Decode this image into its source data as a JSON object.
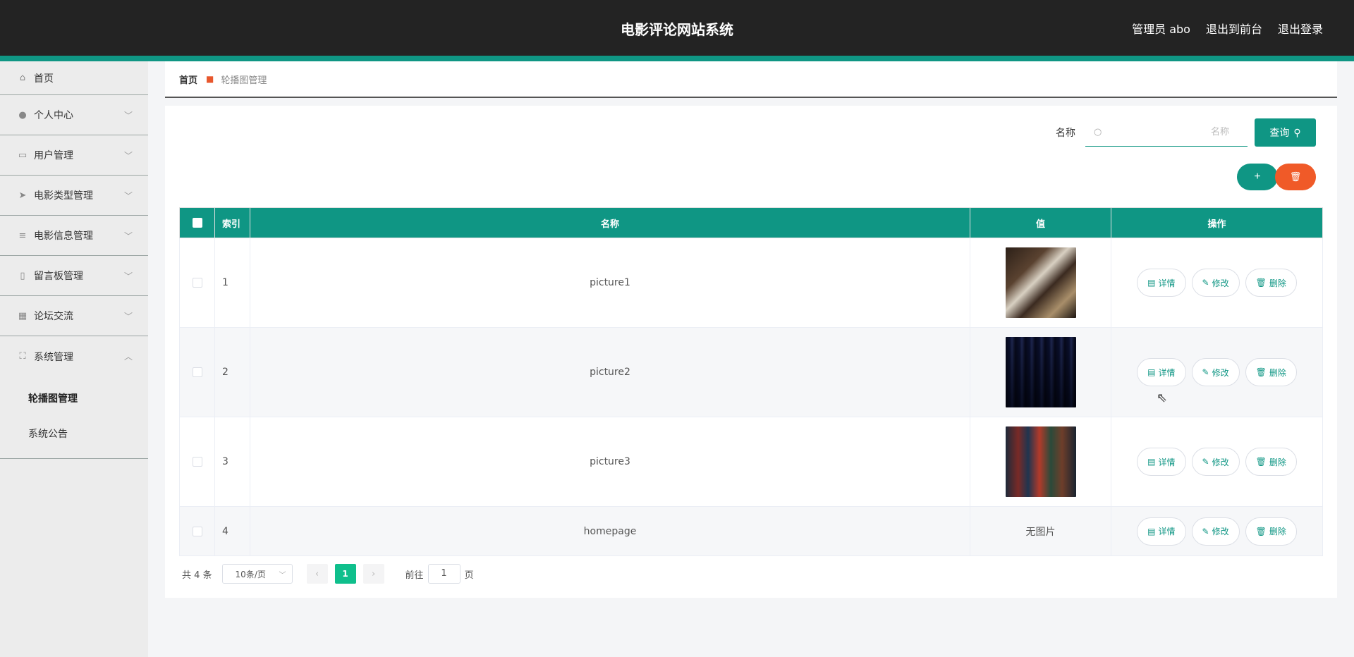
{
  "header": {
    "title": "电影评论网站系统",
    "user": "管理员 abo",
    "to_front": "退出到前台",
    "logout": "退出登录"
  },
  "sidebar": {
    "items": [
      {
        "label": "首页",
        "icon": "home-icon"
      },
      {
        "label": "个人中心",
        "icon": "user-icon"
      },
      {
        "label": "用户管理",
        "icon": "chat-icon"
      },
      {
        "label": "电影类型管理",
        "icon": "send-icon"
      },
      {
        "label": "电影信息管理",
        "icon": "list-icon"
      },
      {
        "label": "留言板管理",
        "icon": "mic-icon"
      },
      {
        "label": "论坛交流",
        "icon": "grid-icon"
      },
      {
        "label": "系统管理",
        "icon": "frame-icon"
      }
    ],
    "sub_items": [
      {
        "label": "轮播图管理",
        "active": true
      },
      {
        "label": "系统公告",
        "active": false
      }
    ]
  },
  "breadcrumb": {
    "home": "首页",
    "current": "轮播图管理"
  },
  "search": {
    "label": "名称",
    "placeholder": "名称",
    "button": "查询"
  },
  "table": {
    "headers": [
      "索引",
      "名称",
      "值",
      "操作"
    ],
    "rows": [
      {
        "index": "1",
        "name": "picture1",
        "value": "image"
      },
      {
        "index": "2",
        "name": "picture2",
        "value": "image"
      },
      {
        "index": "3",
        "name": "picture3",
        "value": "image"
      },
      {
        "index": "4",
        "name": "homepage",
        "value": "无图片"
      }
    ],
    "actions": {
      "detail": "详情",
      "edit": "修改",
      "delete": "删除"
    }
  },
  "pagination": {
    "total": "共 4 条",
    "page_size": "10条/页",
    "current_page": "1",
    "goto_label": "前往",
    "goto_value": "1",
    "page_suffix": "页"
  },
  "colors": {
    "accent": "#0f9684",
    "danger": "#f05a28",
    "topbar": "#232323"
  }
}
